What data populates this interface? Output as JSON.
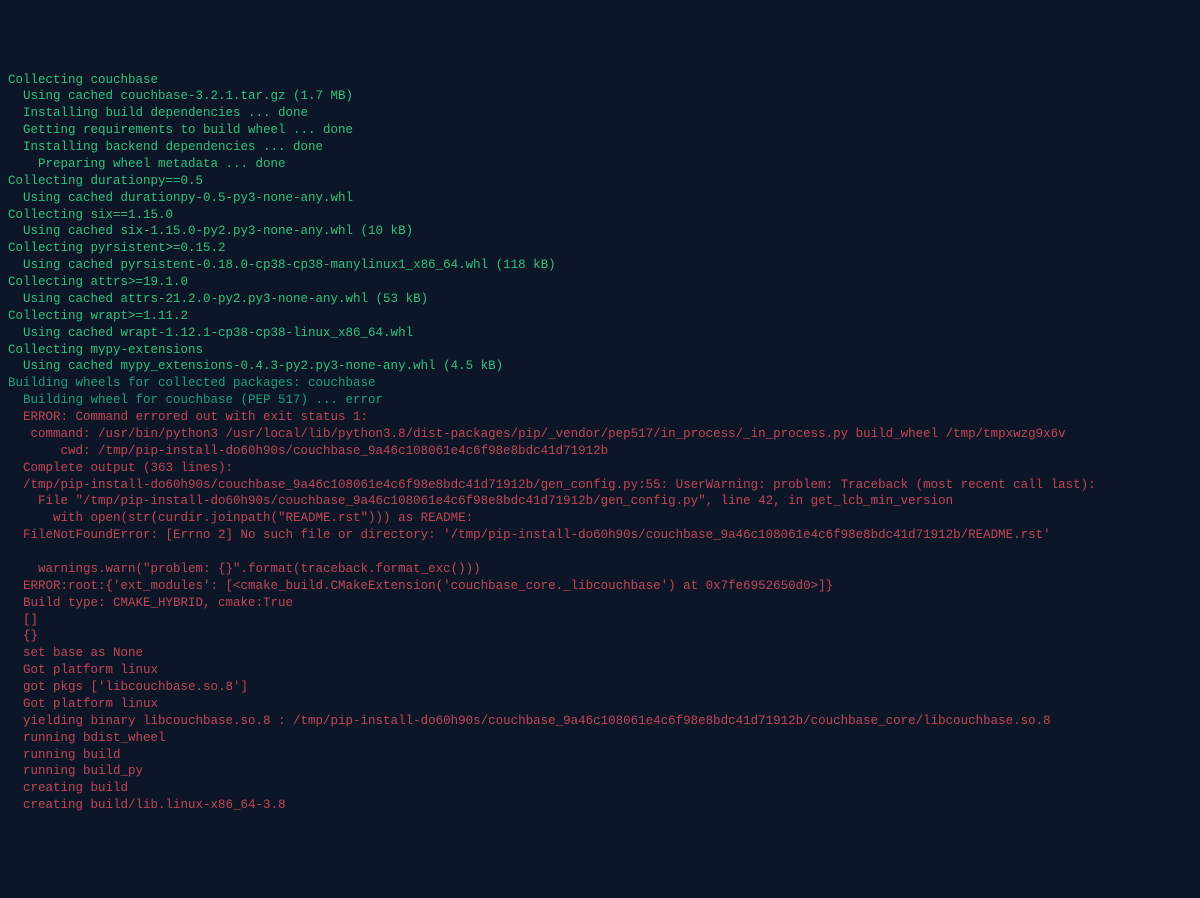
{
  "colors": {
    "background": "#0d1626",
    "green": "#2ec27e",
    "teal": "#1aa179",
    "red": "#c04657"
  },
  "lines": [
    {
      "cls": "green",
      "text": "Collecting couchbase"
    },
    {
      "cls": "green",
      "text": "  Using cached couchbase-3.2.1.tar.gz (1.7 MB)"
    },
    {
      "cls": "green",
      "text": "  Installing build dependencies ... done"
    },
    {
      "cls": "green",
      "text": "  Getting requirements to build wheel ... done"
    },
    {
      "cls": "green",
      "text": "  Installing backend dependencies ... done"
    },
    {
      "cls": "green",
      "text": "    Preparing wheel metadata ... done"
    },
    {
      "cls": "green",
      "text": "Collecting durationpy==0.5"
    },
    {
      "cls": "green",
      "text": "  Using cached durationpy-0.5-py3-none-any.whl"
    },
    {
      "cls": "green",
      "text": "Collecting six==1.15.0"
    },
    {
      "cls": "green",
      "text": "  Using cached six-1.15.0-py2.py3-none-any.whl (10 kB)"
    },
    {
      "cls": "green",
      "text": "Collecting pyrsistent>=0.15.2"
    },
    {
      "cls": "green",
      "text": "  Using cached pyrsistent-0.18.0-cp38-cp38-manylinux1_x86_64.whl (118 kB)"
    },
    {
      "cls": "green",
      "text": "Collecting attrs>=19.1.0"
    },
    {
      "cls": "green",
      "text": "  Using cached attrs-21.2.0-py2.py3-none-any.whl (53 kB)"
    },
    {
      "cls": "green",
      "text": "Collecting wrapt>=1.11.2"
    },
    {
      "cls": "green",
      "text": "  Using cached wrapt-1.12.1-cp38-cp38-linux_x86_64.whl"
    },
    {
      "cls": "green",
      "text": "Collecting mypy-extensions"
    },
    {
      "cls": "green",
      "text": "  Using cached mypy_extensions-0.4.3-py2.py3-none-any.whl (4.5 kB)"
    },
    {
      "cls": "teal",
      "text": "Building wheels for collected packages: couchbase"
    },
    {
      "cls": "teal",
      "text": "  Building wheel for couchbase (PEP 517) ... error"
    },
    {
      "cls": "red",
      "text": "  ERROR: Command errored out with exit status 1:"
    },
    {
      "cls": "red",
      "text": "   command: /usr/bin/python3 /usr/local/lib/python3.8/dist-packages/pip/_vendor/pep517/in_process/_in_process.py build_wheel /tmp/tmpxwzg9x6v"
    },
    {
      "cls": "red",
      "text": "       cwd: /tmp/pip-install-do60h90s/couchbase_9a46c108061e4c6f98e8bdc41d71912b"
    },
    {
      "cls": "red",
      "text": "  Complete output (363 lines):"
    },
    {
      "cls": "red",
      "text": "  /tmp/pip-install-do60h90s/couchbase_9a46c108061e4c6f98e8bdc41d71912b/gen_config.py:55: UserWarning: problem: Traceback (most recent call last):"
    },
    {
      "cls": "red",
      "text": "    File \"/tmp/pip-install-do60h90s/couchbase_9a46c108061e4c6f98e8bdc41d71912b/gen_config.py\", line 42, in get_lcb_min_version"
    },
    {
      "cls": "red",
      "text": "      with open(str(curdir.joinpath(\"README.rst\"))) as README:"
    },
    {
      "cls": "red",
      "text": "  FileNotFoundError: [Errno 2] No such file or directory: '/tmp/pip-install-do60h90s/couchbase_9a46c108061e4c6f98e8bdc41d71912b/README.rst'"
    },
    {
      "cls": "red",
      "text": "  "
    },
    {
      "cls": "red",
      "text": "    warnings.warn(\"problem: {}\".format(traceback.format_exc()))"
    },
    {
      "cls": "red",
      "text": "  ERROR:root:{'ext_modules': [<cmake_build.CMakeExtension('couchbase_core._libcouchbase') at 0x7fe6952650d0>]}"
    },
    {
      "cls": "red",
      "text": "  Build type: CMAKE_HYBRID, cmake:True"
    },
    {
      "cls": "red",
      "text": "  []"
    },
    {
      "cls": "red",
      "text": "  {}"
    },
    {
      "cls": "red",
      "text": "  set base as None"
    },
    {
      "cls": "red",
      "text": "  Got platform linux"
    },
    {
      "cls": "red",
      "text": "  got pkgs ['libcouchbase.so.8']"
    },
    {
      "cls": "red",
      "text": "  Got platform linux"
    },
    {
      "cls": "red",
      "text": "  yielding binary libcouchbase.so.8 : /tmp/pip-install-do60h90s/couchbase_9a46c108061e4c6f98e8bdc41d71912b/couchbase_core/libcouchbase.so.8"
    },
    {
      "cls": "red",
      "text": "  running bdist_wheel"
    },
    {
      "cls": "red",
      "text": "  running build"
    },
    {
      "cls": "red",
      "text": "  running build_py"
    },
    {
      "cls": "red",
      "text": "  creating build"
    },
    {
      "cls": "red",
      "text": "  creating build/lib.linux-x86_64-3.8"
    }
  ]
}
